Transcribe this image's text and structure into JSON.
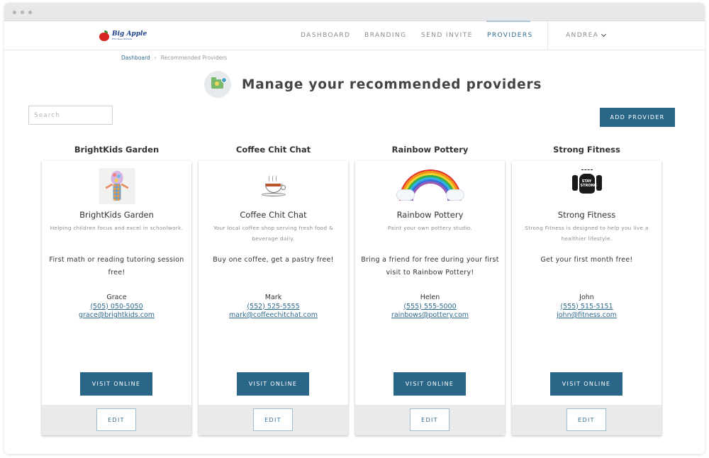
{
  "app": {
    "logo_main": "Big Apple",
    "logo_sub": "PTO Real Estate"
  },
  "nav": {
    "items": [
      {
        "label": "DASHBOARD"
      },
      {
        "label": "BRANDING"
      },
      {
        "label": "SEND INVITE"
      },
      {
        "label": "PROVIDERS",
        "active": true
      }
    ],
    "user_label": "ANDREA"
  },
  "breadcrumb": {
    "home": "Dashboard",
    "separator": "›",
    "current": "Recommended Providers"
  },
  "page": {
    "title": "Manage your recommended providers",
    "icon": "folder-image-icon"
  },
  "search": {
    "placeholder": "Search",
    "value": ""
  },
  "add_button_label": "ADD PROVIDER",
  "providers": [
    {
      "column_title": "BrightKids Garden",
      "name": "BrightKids Garden",
      "description": "Helping children focus and excel in schoolwork.",
      "offer": "First math or reading tutoring session free!",
      "contact_name": "Grace",
      "phone": "(505) 050-5050",
      "email": "grace@brightkids.com",
      "visit_label": "VISIT ONLINE",
      "edit_label": "EDIT",
      "image": "lightbulb-child-image"
    },
    {
      "column_title": "Coffee Chit Chat",
      "name": "Coffee Chit Chat",
      "description": "Your local coffee shop serving fresh food & beverage daily.",
      "offer": "Buy one coffee, get a pastry free!",
      "contact_name": "Mark",
      "phone": "(552) 525-5555",
      "email": "mark@coffeechitchat.com",
      "visit_label": "VISIT ONLINE",
      "edit_label": "EDIT",
      "image": "coffee-cup-image"
    },
    {
      "column_title": "Rainbow Pottery",
      "name": "Rainbow Pottery",
      "description": "Paint your own pottery studio.",
      "offer": "Bring a friend for free during your first visit to Rainbow Pottery!",
      "contact_name": "Helen",
      "phone": "(555) 555-5000",
      "email": "rainbows@pottery.com",
      "visit_label": "VISIT ONLINE",
      "edit_label": "EDIT",
      "image": "rainbow-image"
    },
    {
      "column_title": "Strong Fitness",
      "name": "Strong Fitness",
      "description": "Strong Fitness is designed to help you live a healthier lifestyle.",
      "offer": "Get your first month free!",
      "contact_name": "John",
      "phone": "(555) 515-5151",
      "email": "john@fitness.com",
      "visit_label": "VISIT ONLINE",
      "edit_label": "EDIT",
      "image": "stay-strong-fist-image",
      "logo_text": "STAY STRONG"
    }
  ],
  "colors": {
    "primary": "#2a6688",
    "link": "#2e6a8e",
    "nav_inactive": "#8b8b8b",
    "footer_bg": "#eaeaea"
  }
}
